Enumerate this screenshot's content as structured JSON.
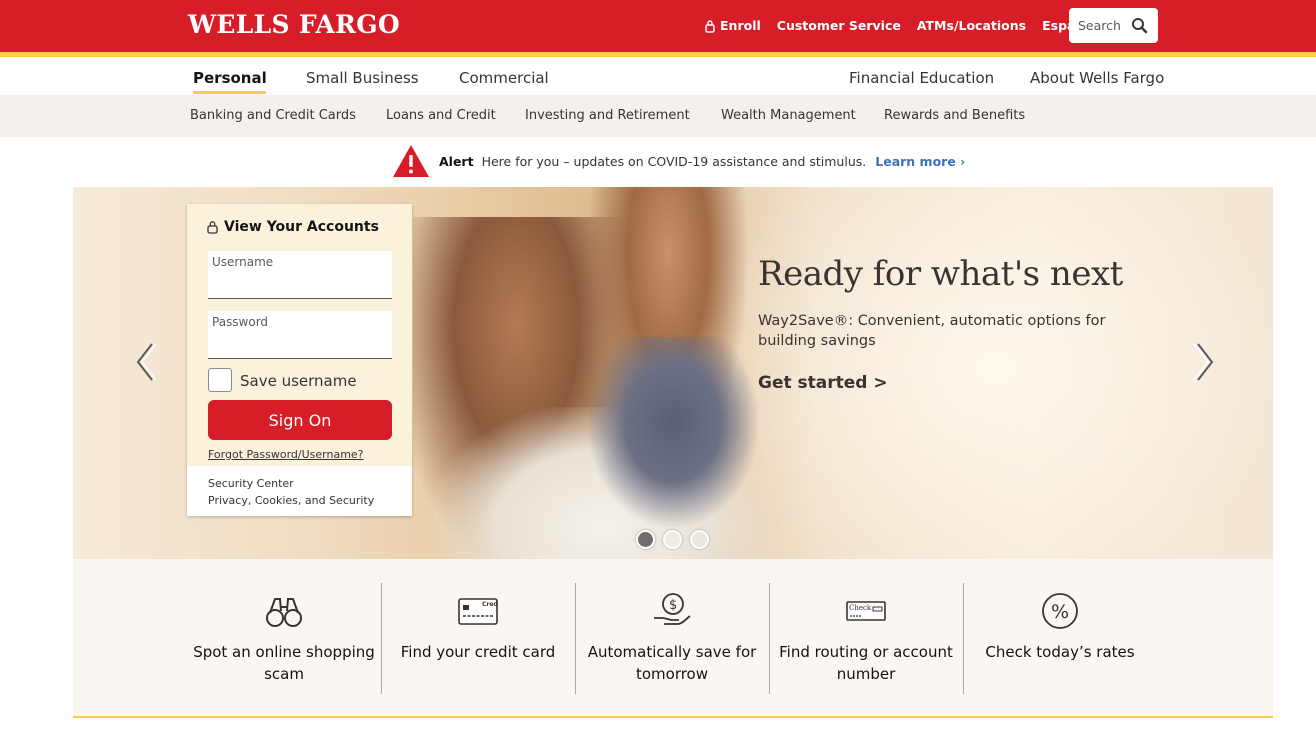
{
  "header": {
    "logo": "WELLS FARGO",
    "links": [
      "Enroll",
      "Customer Service",
      "ATMs/Locations",
      "Español"
    ],
    "search_label": "Search",
    "colors": {
      "brand_red": "#d71e28",
      "brand_gold": "#ffcd41"
    }
  },
  "main_nav": {
    "left": [
      "Personal",
      "Small Business",
      "Commercial"
    ],
    "right": [
      "Financial Education",
      "About Wells Fargo"
    ],
    "active": "Personal"
  },
  "sub_nav": [
    "Banking and Credit Cards",
    "Loans and Credit",
    "Investing and Retirement",
    "Wealth Management",
    "Rewards and Benefits"
  ],
  "alert": {
    "title": "Alert",
    "text": "Here for you – updates on COVID-19 assistance and stimulus.",
    "link": "Learn more"
  },
  "login": {
    "heading": "View Your Accounts",
    "username_label": "Username",
    "password_label": "Password",
    "save_username": "Save username",
    "sign_on": "Sign On",
    "forgot": "Forgot Password/Username?",
    "footer_links": [
      "Security Center",
      "Privacy, Cookies, and Security"
    ]
  },
  "hero": {
    "title": "Ready for what's next",
    "subtitle": "Way2Save®: Convenient, automatic options for building savings",
    "cta": "Get started >",
    "slides": 3,
    "active_slide": 1
  },
  "features": [
    {
      "label": "Spot an online shopping scam",
      "icon": "binoculars-icon"
    },
    {
      "label": "Find your credit card",
      "icon": "credit-card-icon"
    },
    {
      "label": "Automatically save for tomorrow",
      "icon": "hand-coin-icon"
    },
    {
      "label": "Find routing or account number",
      "icon": "check-icon"
    },
    {
      "label": "Check today’s rates",
      "icon": "percent-icon"
    }
  ]
}
